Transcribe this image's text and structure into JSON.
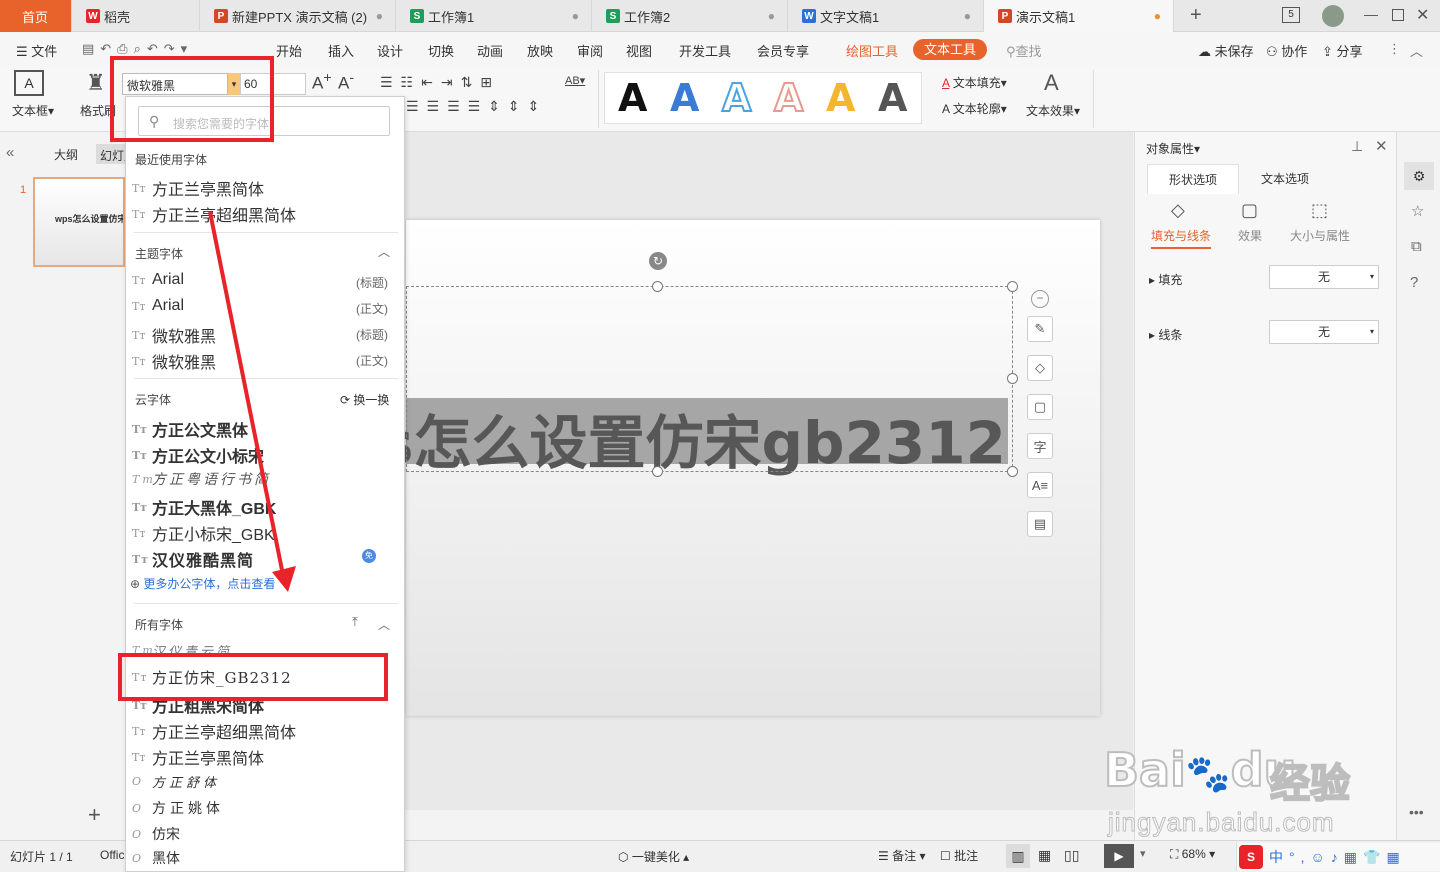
{
  "tabs": [
    {
      "label": "首页",
      "active": true
    },
    {
      "label": "稻壳",
      "icon": "wps-icon"
    },
    {
      "label": "新建PPTX 演示文稿 (2)",
      "icon": "ppt-icon"
    },
    {
      "label": "工作簿1",
      "icon": "sheet-icon"
    },
    {
      "label": "工作簿2",
      "icon": "sheet-icon"
    },
    {
      "label": "文字文稿1",
      "icon": "doc-icon"
    },
    {
      "label": "演示文稿1",
      "icon": "ppt-icon",
      "active_doc": true
    }
  ],
  "tab_plus": "+",
  "window_badge": "5",
  "menu": {
    "file": "文件",
    "items": [
      "开始",
      "插入",
      "设计",
      "切换",
      "动画",
      "放映",
      "审阅",
      "视图",
      "开发工具",
      "会员专享"
    ],
    "draw_tools": "绘图工具",
    "text_tools": "文本工具",
    "search": "查找",
    "unsaved": "未保存",
    "collab": "协作",
    "share": "分享"
  },
  "ribbon": {
    "textbox": "文本框",
    "format": "格式刷",
    "font_name": "微软雅黑",
    "font_size": "60",
    "text_fill": "文本填充",
    "text_outline": "文本轮廓",
    "text_effect": "文本效果",
    "art_letter": "A"
  },
  "left": {
    "outline": "大纲",
    "slides": "幻灯片",
    "slide_num": "1",
    "thumb_text": "wps怎么设置仿宋gb2312"
  },
  "slide": {
    "title": "wps怎么设置仿宋gb2312"
  },
  "fontdrop": {
    "search_placeholder": "搜索您需要的字体",
    "recent_title": "最近使用字体",
    "recent": [
      "方正兰亭黑简体",
      "方正兰亭超细黑简体"
    ],
    "theme_title": "主题字体",
    "theme": [
      {
        "name": "Arial",
        "tag": "(标题)"
      },
      {
        "name": "Arial",
        "tag": "(正文)"
      },
      {
        "name": "微软雅黑",
        "tag": "(标题)"
      },
      {
        "name": "微软雅黑",
        "tag": "(正文)"
      }
    ],
    "cloud_title": "云字体",
    "cloud_switch": "换一换",
    "cloud": [
      "方正公文黑体",
      "方正公文小标宋",
      "方正粤语行书简",
      "方正大黑体_GBK",
      "方正小标宋_GBK",
      "汉仪雅酷黑简"
    ],
    "more_link": "更多办公字体，点击查看",
    "all_title": "所有字体",
    "all": [
      "汉仪青云简",
      "方正仿宋_GB2312",
      "方正粗黑宋简体",
      "方正兰亭超细黑简体",
      "方正兰亭黑简体",
      "方正舒体",
      "方正姚体",
      "仿宋",
      "黑体"
    ]
  },
  "right": {
    "title": "对象属性",
    "tab_shape": "形状选项",
    "tab_text": "文本选项",
    "sub": [
      "填充与线条",
      "效果",
      "大小与属性"
    ],
    "fill_label": "填充",
    "fill_value": "无",
    "line_label": "线条",
    "line_value": "无"
  },
  "status": {
    "slide": "幻灯片 1 / 1",
    "theme": "Office",
    "beautify": "一键美化",
    "notes": "备注",
    "comment": "批注",
    "zoom": "68%"
  },
  "watermark": {
    "brand": "Bai",
    "brand2": "du",
    "cn": "经验",
    "url": "jingyan.baidu.com"
  },
  "colors": {
    "accent": "#e8632c",
    "red": "#e8232a",
    "tab_active_ppt": "#d24726",
    "sheet": "#1e9e5a",
    "doc": "#2b6fd8"
  }
}
